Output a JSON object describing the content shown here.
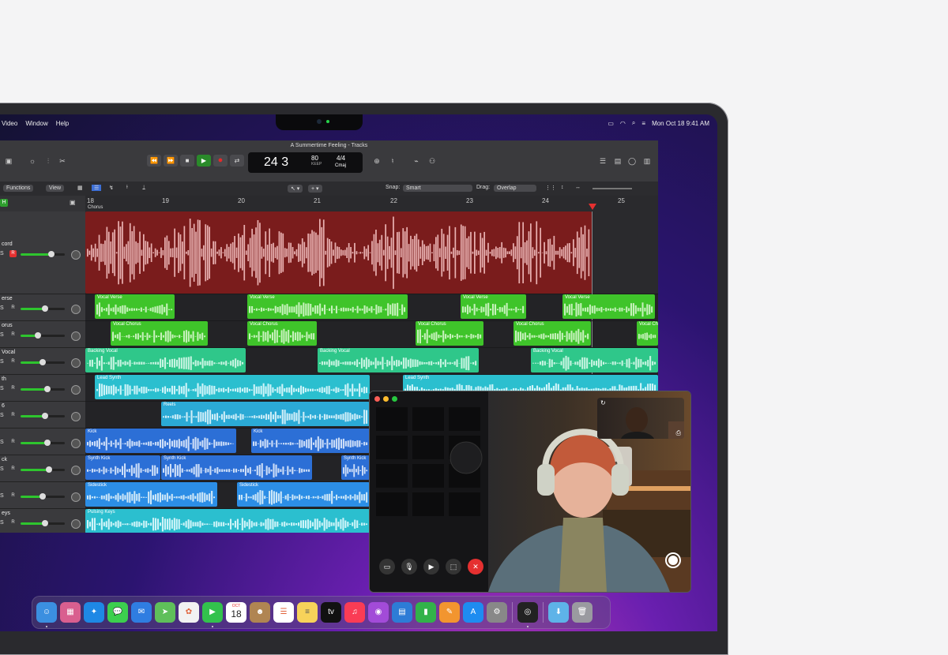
{
  "menubar": {
    "left_items": [
      "Video",
      "Window",
      "Help"
    ],
    "date_time": "Mon Oct 18  9:41 AM"
  },
  "logic": {
    "window_title": "A Summertime Feeling - Tracks",
    "lcd": {
      "position": "24 3",
      "bpm": "80",
      "keep": "KEEP",
      "time_signature": "4/4",
      "key": "Cmaj"
    },
    "toolbar": {
      "functions": "Functions",
      "view": "View",
      "snap_label": "Snap:",
      "snap_value": "Smart",
      "drag_label": "Drag:",
      "drag_value": "Overlap"
    },
    "ruler_bars": [
      "18",
      "19",
      "20",
      "21",
      "22",
      "23",
      "24",
      "25"
    ],
    "arrangement_marker": "Chorus",
    "track_headers": [
      {
        "name": "cord"
      },
      {
        "name": "erse"
      },
      {
        "name": "orus"
      },
      {
        "name": "Vocal"
      },
      {
        "name": "th"
      },
      {
        "name": "6"
      },
      {
        "name": ""
      },
      {
        "name": "ck"
      },
      {
        "name": ""
      },
      {
        "name": "eys"
      }
    ],
    "regions": {
      "vocal_verse": "Vocal Verse",
      "vocal_chorus": "Vocal Chorus",
      "vocal_chorus_trunc": "Vocal Ch",
      "backing_vocal": "Backing Vocal",
      "lead_synth": "Lead Synth",
      "reels": "Reels",
      "kick": "Kick",
      "synth_kick": "Synth Kick",
      "sidestick": "Sidestick",
      "pulsing_keys": "Pulsing Keys"
    }
  },
  "dock": {
    "calendar_month": "OCT",
    "calendar_day": "18",
    "apps": [
      "finder-icon",
      "launchpad-icon",
      "safari-icon",
      "messages-icon",
      "mail-icon",
      "maps-icon",
      "photos-icon",
      "facetime-icon",
      "calendar-icon",
      "contacts-icon",
      "reminders-icon",
      "notes-icon",
      "apple-tv-icon",
      "music-icon",
      "podcasts-icon",
      "keynote-icon",
      "numbers-icon",
      "pages-icon",
      "app-store-icon",
      "system-preferences-icon",
      "logic-pro-icon",
      "downloads-folder-icon",
      "trash-icon"
    ]
  },
  "colors": {
    "accent_green": "#2ec52e",
    "record_red": "#e53030",
    "audio_region": "#7a1c1c",
    "region_green": "#3fc42a",
    "region_teal": "#2bbfa7",
    "region_blue": "#2c6fd6"
  }
}
